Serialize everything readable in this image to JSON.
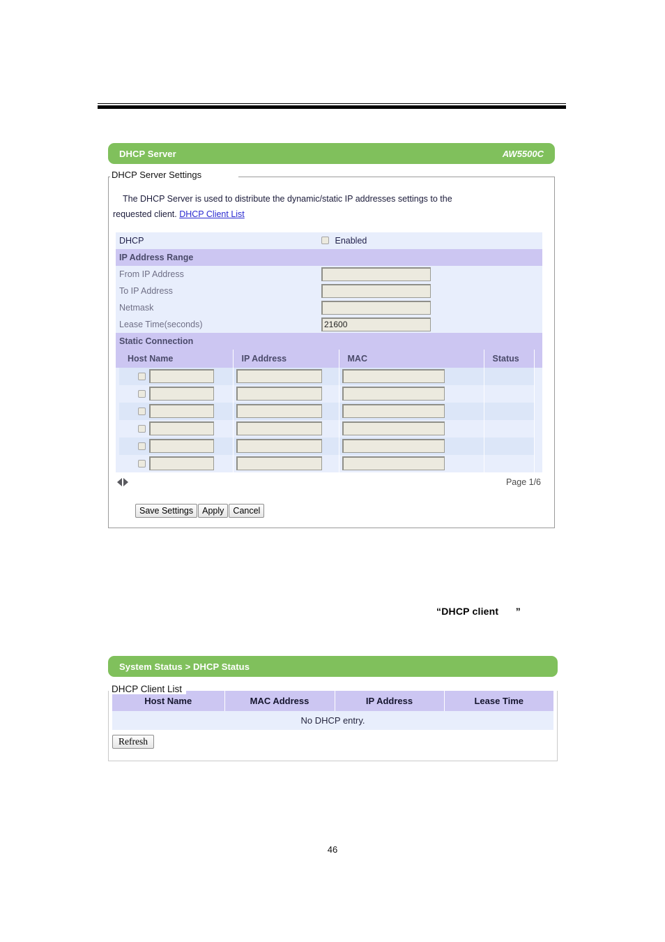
{
  "document": {
    "page_number": "46",
    "annotation": "“DHCP client      ”"
  },
  "panel_dhcp_server": {
    "title": "DHCP Server",
    "model": "AW5500C",
    "fieldset_legend": "DHCP Server Settings",
    "intro_line1": "The DHCP Server is used to distribute the dynamic/static IP addresses settings to the",
    "intro_line2": "requested client.",
    "intro_link": "DHCP Client List",
    "settings": {
      "dhcp_label": "DHCP",
      "enabled_label": "Enabled",
      "enabled_checked": false,
      "ip_range_section": "IP Address Range",
      "fields": [
        {
          "label": "From IP Address",
          "value": ""
        },
        {
          "label": "To IP Address",
          "value": ""
        },
        {
          "label": "Netmask",
          "value": ""
        },
        {
          "label": "Lease Time(seconds)",
          "value": "21600"
        }
      ],
      "static_section": "Static Connection",
      "static_headers": [
        "Host Name",
        "IP Address",
        "MAC",
        "Status"
      ],
      "static_rows": [
        {
          "checked": false,
          "host_name": "",
          "ip_address": "",
          "mac": "",
          "status": ""
        },
        {
          "checked": false,
          "host_name": "",
          "ip_address": "",
          "mac": "",
          "status": ""
        },
        {
          "checked": false,
          "host_name": "",
          "ip_address": "",
          "mac": "",
          "status": ""
        },
        {
          "checked": false,
          "host_name": "",
          "ip_address": "",
          "mac": "",
          "status": ""
        },
        {
          "checked": false,
          "host_name": "",
          "ip_address": "",
          "mac": "",
          "status": ""
        },
        {
          "checked": false,
          "host_name": "",
          "ip_address": "",
          "mac": "",
          "status": ""
        }
      ]
    },
    "pager": {
      "prev_icon": "triangle-left-icon",
      "next_icon": "triangle-right-icon",
      "page_label": "Page 1/6"
    },
    "buttons": {
      "save": "Save Settings",
      "apply": "Apply",
      "cancel": "Cancel"
    }
  },
  "panel_dhcp_status": {
    "title": "System Status > DHCP Status",
    "fieldset_legend": "DHCP Client List",
    "headers": [
      "Host Name",
      "MAC Address",
      "IP Address",
      "Lease Time"
    ],
    "empty_message": "No DHCP entry.",
    "refresh_label": "Refresh"
  },
  "colors": {
    "green_header": "#80c05c",
    "section_purple": "#ccc6f2",
    "row_light": "#e8eefc",
    "row_alt": "#dce6f8",
    "link_blue": "#2a2ad0",
    "input_bg": "#eceadf"
  }
}
